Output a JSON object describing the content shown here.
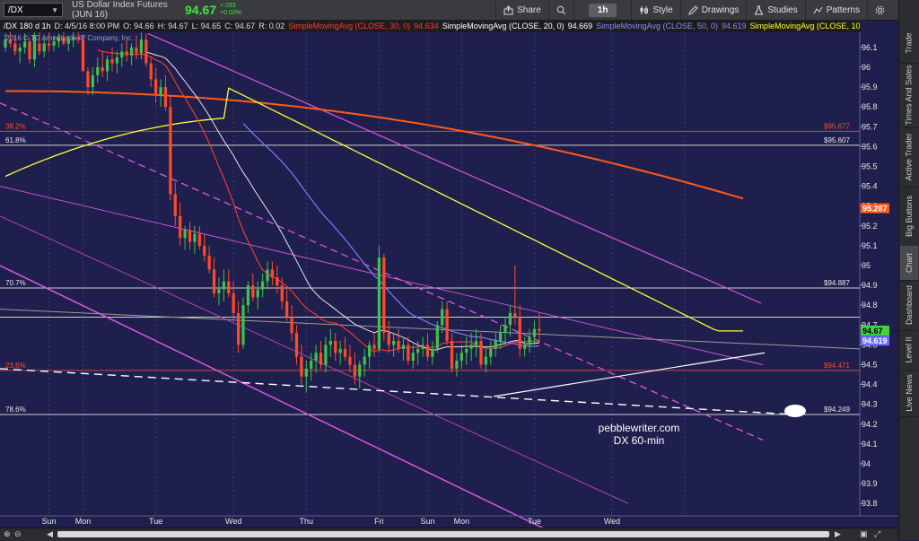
{
  "toolbar": {
    "symbol": "/DX",
    "title": "US Dollar Index Futures (JUN 16)",
    "last_price": "94.67",
    "change": "+.033",
    "change_pct": "+0.03%",
    "share_label": "Share",
    "timeframe": "1h",
    "style_label": "Style",
    "drawings_label": "Drawings",
    "studies_label": "Studies",
    "patterns_label": "Patterns"
  },
  "infobar": {
    "symbol_period": "/DX 180 d 1h",
    "date": "D: 4/5/16 8:00 PM",
    "open": "O: 94.66",
    "high": "H: 94.67",
    "low": "L: 94.65",
    "close": "C: 94.67",
    "range": "R: 0.02",
    "sma30": "SimpleMovingAvg (CLOSE, 30, 0)",
    "sma30_val": "94.634",
    "sma20": "SimpleMovingAvg (CLOSE, 20, 0)",
    "sma20_val": "94.669",
    "sma50": "SimpleMovingAvg (CLOSE, 50, 0)",
    "sma50_val": "94.619",
    "sma100": "SimpleMovingAvg (CLOSE, 100, 0)"
  },
  "copyright": "2016 © TD Ameritrade IP Company, Inc.",
  "right_tabs": [
    "Trade",
    "Times And Sales",
    "Active Trader",
    "Big Buttons",
    "Chart",
    "Dashboard",
    "Level II",
    "Live News"
  ],
  "watermark": [
    "pebblewriter.com",
    "DX 60-min"
  ],
  "chart_data": {
    "type": "candlestick",
    "y_axis": {
      "min": 93.75,
      "max": 96.2,
      "ticks": [
        93.8,
        93.9,
        94,
        94.1,
        94.2,
        94.3,
        94.4,
        94.5,
        94.6,
        94.7,
        94.8,
        94.9,
        95,
        95.1,
        95.2,
        95.3,
        95.4,
        95.5,
        95.6,
        95.7,
        95.8,
        95.9,
        96,
        96.1
      ],
      "tick_labels": [
        "93.8",
        "93.9",
        "94",
        "94.1",
        "94.2",
        "94.3",
        "94.4",
        "94.5",
        "94.6",
        "94.7",
        "94.8",
        "94.9",
        "95",
        "95.1",
        "95.2",
        "95.3",
        "95.4",
        "95.5",
        "95.6",
        "95.7",
        "95.8",
        "95.9",
        "96",
        "96.1"
      ]
    },
    "x_axis": {
      "bars": 153,
      "labels": [
        {
          "bar": 9,
          "text": "Sun"
        },
        {
          "bar": 16,
          "text": "Mon"
        },
        {
          "bar": 31,
          "text": "Tue"
        },
        {
          "bar": 47,
          "text": "Wed"
        },
        {
          "bar": 62,
          "text": "Thu"
        },
        {
          "bar": 77,
          "text": "Fri"
        },
        {
          "bar": 87,
          "text": "Sun"
        },
        {
          "bar": 94,
          "text": "Mon"
        },
        {
          "bar": 109,
          "text": "Tue"
        },
        {
          "bar": 125,
          "text": "Wed"
        }
      ],
      "dividers": [
        9,
        16,
        31,
        47,
        62,
        77,
        87,
        94,
        109,
        125,
        140
      ]
    },
    "ohlc": [
      [
        96.1,
        96.17,
        96.08,
        96.14
      ],
      [
        96.14,
        96.19,
        96.1,
        96.12
      ],
      [
        96.12,
        96.16,
        96.06,
        96.08
      ],
      [
        96.08,
        96.12,
        96.02,
        96.1
      ],
      [
        96.1,
        96.17,
        96.07,
        96.13
      ],
      [
        96.13,
        96.15,
        96.02,
        96.04
      ],
      [
        96.04,
        96.2,
        96.0,
        96.16
      ],
      [
        96.12,
        96.19,
        96.06,
        96.08
      ],
      [
        96.08,
        96.15,
        96.05,
        96.12
      ],
      [
        96.12,
        96.18,
        96.08,
        96.11
      ],
      [
        96.11,
        96.16,
        96.08,
        96.13
      ],
      [
        96.13,
        96.17,
        96.1,
        96.15
      ],
      [
        96.15,
        96.19,
        96.11,
        96.12
      ],
      [
        96.12,
        96.16,
        96.08,
        96.14
      ],
      [
        96.14,
        96.18,
        96.1,
        96.15
      ],
      [
        96.15,
        96.19,
        96.12,
        96.14
      ],
      [
        96.14,
        96.16,
        95.98,
        95.98
      ],
      [
        95.98,
        96.0,
        95.86,
        95.9
      ],
      [
        95.9,
        96.0,
        95.86,
        95.96
      ],
      [
        95.96,
        96.05,
        95.92,
        96.0
      ],
      [
        96.0,
        96.08,
        95.95,
        95.98
      ],
      [
        95.98,
        96.06,
        95.93,
        96.04
      ],
      [
        96.04,
        96.1,
        95.98,
        96.02
      ],
      [
        96.02,
        96.08,
        95.97,
        96.05
      ],
      [
        96.05,
        96.12,
        96.0,
        96.08
      ],
      [
        96.08,
        96.14,
        96.03,
        96.06
      ],
      [
        96.06,
        96.12,
        96.01,
        96.1
      ],
      [
        96.1,
        96.16,
        96.04,
        96.07
      ],
      [
        96.07,
        96.18,
        96.04,
        96.14
      ],
      [
        96.14,
        96.17,
        96.0,
        96.02
      ],
      [
        96.02,
        96.05,
        95.9,
        95.94
      ],
      [
        95.94,
        96.0,
        95.82,
        95.86
      ],
      [
        95.86,
        95.94,
        95.8,
        95.9
      ],
      [
        95.9,
        95.96,
        95.78,
        95.8
      ],
      [
        95.8,
        95.86,
        95.33,
        95.36
      ],
      [
        95.36,
        95.42,
        95.2,
        95.25
      ],
      [
        95.25,
        95.32,
        95.1,
        95.14
      ],
      [
        95.14,
        95.2,
        95.08,
        95.18
      ],
      [
        95.18,
        95.22,
        95.08,
        95.12
      ],
      [
        95.12,
        95.2,
        95.06,
        95.16
      ],
      [
        95.16,
        95.2,
        95.08,
        95.1
      ],
      [
        95.1,
        95.16,
        95.02,
        95.05
      ],
      [
        95.05,
        95.1,
        94.96,
        94.98
      ],
      [
        94.98,
        95.04,
        94.84,
        94.86
      ],
      [
        94.86,
        94.94,
        94.8,
        94.88
      ],
      [
        94.88,
        94.98,
        94.82,
        94.92
      ],
      [
        94.92,
        94.98,
        94.84,
        94.86
      ],
      [
        94.86,
        94.92,
        94.72,
        94.76
      ],
      [
        94.76,
        94.82,
        94.56,
        94.6
      ],
      [
        94.6,
        94.84,
        94.58,
        94.8
      ],
      [
        94.8,
        94.92,
        94.76,
        94.9
      ],
      [
        94.9,
        94.96,
        94.82,
        94.84
      ],
      [
        94.84,
        94.92,
        94.78,
        94.88
      ],
      [
        94.88,
        94.96,
        94.84,
        94.92
      ],
      [
        94.92,
        95.02,
        94.88,
        94.98
      ],
      [
        94.98,
        95.02,
        94.9,
        94.94
      ],
      [
        94.94,
        95.0,
        94.86,
        94.9
      ],
      [
        94.9,
        94.94,
        94.78,
        94.82
      ],
      [
        94.82,
        94.88,
        94.72,
        94.74
      ],
      [
        94.74,
        94.8,
        94.62,
        94.66
      ],
      [
        94.66,
        94.7,
        94.5,
        94.54
      ],
      [
        94.54,
        94.6,
        94.4,
        94.44
      ],
      [
        94.44,
        94.52,
        94.36,
        94.48
      ],
      [
        94.48,
        94.56,
        94.42,
        94.52
      ],
      [
        94.52,
        94.6,
        94.46,
        94.56
      ],
      [
        94.56,
        94.62,
        94.48,
        94.5
      ],
      [
        94.5,
        94.64,
        94.46,
        94.6
      ],
      [
        94.6,
        94.68,
        94.54,
        94.62
      ],
      [
        94.62,
        94.66,
        94.52,
        94.56
      ],
      [
        94.56,
        94.62,
        94.5,
        94.58
      ],
      [
        94.58,
        94.64,
        94.52,
        94.54
      ],
      [
        94.54,
        94.6,
        94.46,
        94.5
      ],
      [
        94.5,
        94.56,
        94.4,
        94.44
      ],
      [
        94.44,
        94.52,
        94.38,
        94.5
      ],
      [
        94.5,
        94.58,
        94.44,
        94.54
      ],
      [
        94.54,
        94.62,
        94.48,
        94.6
      ],
      [
        94.6,
        94.66,
        94.54,
        94.58
      ],
      [
        94.58,
        95.1,
        94.56,
        95.04
      ],
      [
        95.04,
        95.06,
        94.62,
        94.66
      ],
      [
        94.66,
        94.72,
        94.56,
        94.6
      ],
      [
        94.6,
        94.66,
        94.54,
        94.62
      ],
      [
        94.62,
        94.68,
        94.56,
        94.58
      ],
      [
        94.58,
        94.64,
        94.52,
        94.6
      ],
      [
        94.6,
        94.64,
        94.5,
        94.52
      ],
      [
        94.52,
        94.6,
        94.48,
        94.56
      ],
      [
        94.56,
        94.62,
        94.5,
        94.58
      ],
      [
        94.58,
        94.64,
        94.54,
        94.6
      ],
      [
        94.6,
        94.66,
        94.52,
        94.54
      ],
      [
        94.54,
        94.62,
        94.5,
        94.58
      ],
      [
        94.58,
        94.72,
        94.56,
        94.7
      ],
      [
        94.7,
        94.82,
        94.66,
        94.78
      ],
      [
        94.78,
        94.82,
        94.6,
        94.62
      ],
      [
        94.62,
        94.66,
        94.46,
        94.48
      ],
      [
        94.48,
        94.56,
        94.44,
        94.52
      ],
      [
        94.52,
        94.6,
        94.48,
        94.56
      ],
      [
        94.56,
        94.64,
        94.5,
        94.58
      ],
      [
        94.58,
        94.66,
        94.52,
        94.6
      ],
      [
        94.6,
        94.68,
        94.54,
        94.62
      ],
      [
        94.62,
        94.66,
        94.48,
        94.5
      ],
      [
        94.5,
        94.58,
        94.46,
        94.54
      ],
      [
        94.54,
        94.62,
        94.5,
        94.58
      ],
      [
        94.58,
        94.66,
        94.54,
        94.62
      ],
      [
        94.62,
        94.7,
        94.58,
        94.66
      ],
      [
        94.66,
        94.74,
        94.6,
        94.7
      ],
      [
        94.7,
        94.8,
        94.64,
        94.76
      ],
      [
        94.76,
        95.0,
        94.7,
        94.74
      ],
      [
        94.74,
        94.8,
        94.54,
        94.58
      ],
      [
        94.58,
        94.64,
        94.54,
        94.6
      ],
      [
        94.6,
        94.68,
        94.56,
        94.64
      ],
      [
        94.64,
        94.72,
        94.6,
        94.68
      ],
      [
        94.68,
        94.76,
        94.62,
        94.67
      ]
    ]
  },
  "price_labels": {
    "fib_382": "38.2%",
    "fib_382_val": "$95.677",
    "fib_618": "61.8%",
    "fib_618_val": "$95.607",
    "fib_707": "70.7%",
    "fib_707_val": "$94.887",
    "fib_236": "23.6%",
    "fib_236_val": "$94.471",
    "fib_786": "78.6%",
    "fib_786_val": "$94.249",
    "sma200_val": "95.287",
    "last_val": "94.67",
    "sma50_val": "94.619"
  },
  "colors": {
    "bg": "#1e1f4c",
    "up": "#3fc24a",
    "down": "#ff4a2a",
    "sma20": "#ff3b30",
    "sma30": "#e8e8e8",
    "sma50": "#7c7cff",
    "sma100": "#ffff33",
    "sma200": "#ff5a1a",
    "channel": "#e055e0",
    "trend": "#ffffff"
  }
}
